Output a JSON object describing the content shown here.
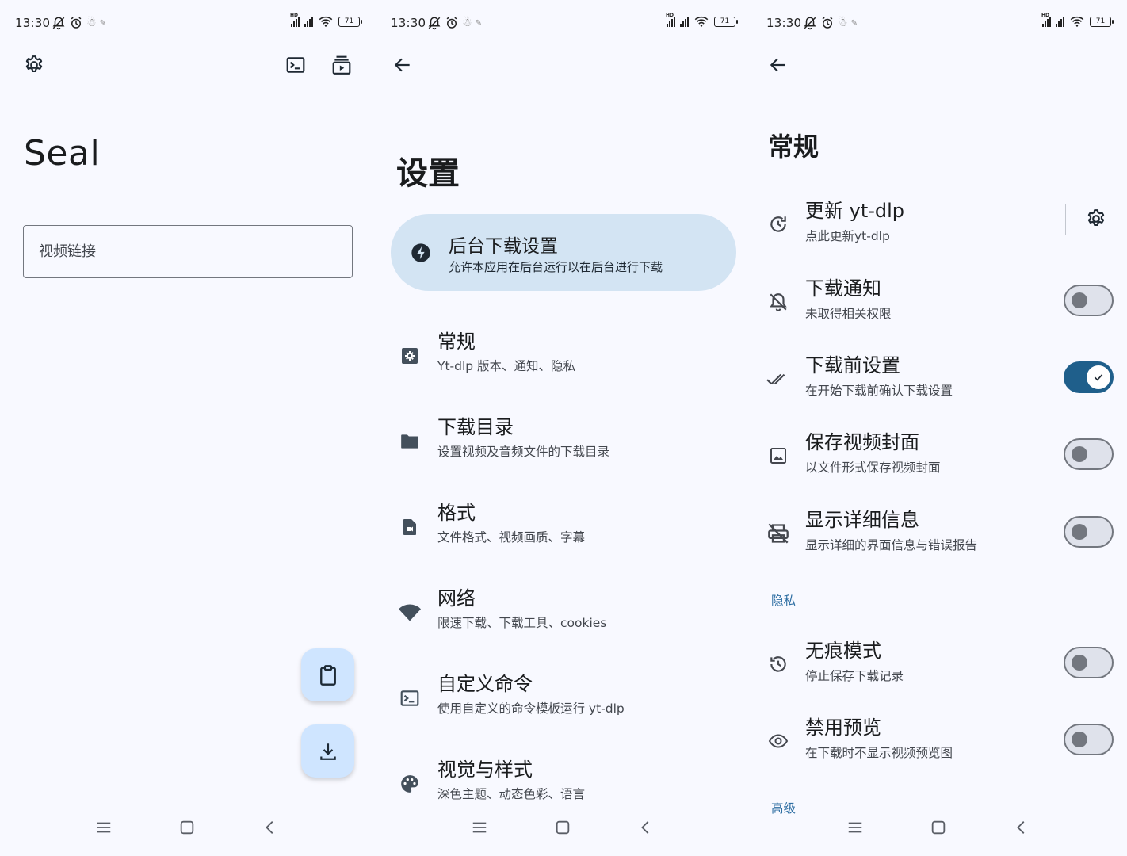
{
  "status_bar": {
    "time": "13:30",
    "battery": "71",
    "icons": [
      "mute-icon",
      "alarm-icon",
      "notification-icon",
      "notification-icon",
      "signal-icon",
      "signal-icon",
      "wifi-icon",
      "battery-icon"
    ]
  },
  "screen1": {
    "app_title": "Seal",
    "url_placeholder": "视频链接",
    "top_icons": [
      "gear-icon",
      "terminal-icon",
      "playlist-icon"
    ],
    "fabs": [
      "clipboard-icon",
      "download-icon"
    ]
  },
  "screen2": {
    "title": "设置",
    "banner": {
      "title": "后台下载设置",
      "subtitle": "允许本应用在后台运行以在后台进行下载",
      "icon": "bolt-icon"
    },
    "items": [
      {
        "title": "常规",
        "subtitle": "Yt-dlp 版本、通知、隐私",
        "icon": "settings-box-icon"
      },
      {
        "title": "下载目录",
        "subtitle": "设置视频及音频文件的下载目录",
        "icon": "folder-icon"
      },
      {
        "title": "格式",
        "subtitle": "文件格式、视频画质、字幕",
        "icon": "video-file-icon"
      },
      {
        "title": "网络",
        "subtitle": "限速下载、下载工具、cookies",
        "icon": "wifi-icon"
      },
      {
        "title": "自定义命令",
        "subtitle": "使用自定义的命令模板运行 yt-dlp",
        "icon": "terminal-icon"
      },
      {
        "title": "视觉与样式",
        "subtitle": "深色主题、动态色彩、语言",
        "icon": "palette-icon"
      }
    ]
  },
  "screen3": {
    "title": "常规",
    "update": {
      "title": "更新 yt-dlp",
      "subtitle": "点此更新yt-dlp",
      "icon": "update-icon"
    },
    "items": [
      {
        "title": "下载通知",
        "subtitle": "未取得相关权限",
        "icon": "notifications-off-icon",
        "on": false
      },
      {
        "title": "下载前设置",
        "subtitle": "在开始下载前确认下载设置",
        "icon": "done-all-icon",
        "on": true
      },
      {
        "title": "保存视频封面",
        "subtitle": "以文件形式保存视频封面",
        "icon": "image-icon",
        "on": false
      },
      {
        "title": "显示详细信息",
        "subtitle": "显示详细的界面信息与错误报告",
        "icon": "print-disabled-icon",
        "on": false
      }
    ],
    "privacy_label": "隐私",
    "privacy_items": [
      {
        "title": "无痕模式",
        "subtitle": "停止保存下载记录",
        "icon": "history-icon",
        "on": false
      },
      {
        "title": "禁用预览",
        "subtitle": "在下载时不显示视频预览图",
        "icon": "eye-icon",
        "on": false
      }
    ],
    "advanced_label": "高级"
  },
  "colors": {
    "background": "#f8f9ff",
    "banner": "#d3e4f3",
    "fab": "#cfe5ff",
    "toggle_on": "#1f5f8b",
    "section_label": "#2f6fa3"
  }
}
